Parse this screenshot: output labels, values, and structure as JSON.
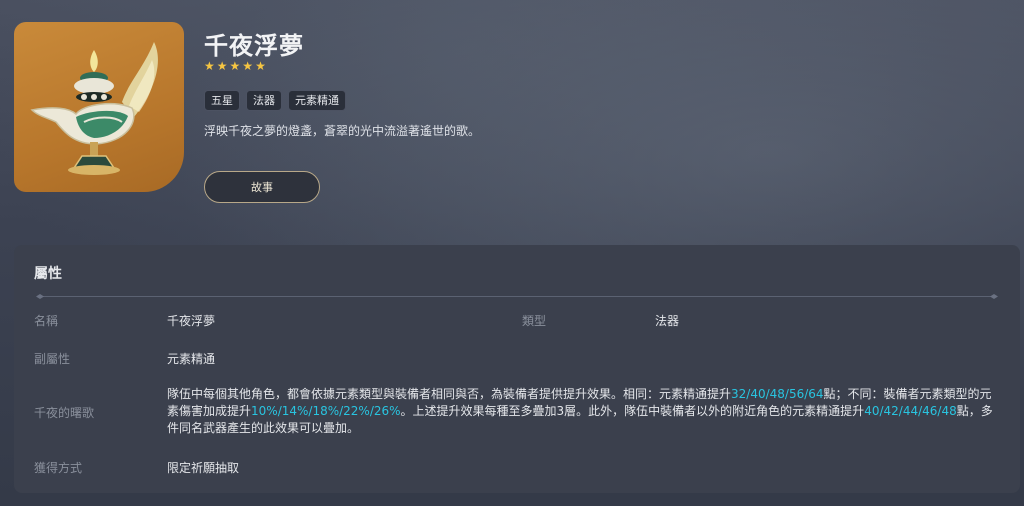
{
  "weapon": {
    "name": "千夜浮夢",
    "rarity": 5,
    "tags": [
      "五星",
      "法器",
      "元素精通"
    ],
    "description": "浮映千夜之夢的燈盞，蒼翠的光中流溢著遙世的歌。",
    "story_button": "故事",
    "image_icon": "magic-lamp-icon"
  },
  "attributes": {
    "section_title": "屬性",
    "name_label": "名稱",
    "name_value": "千夜浮夢",
    "type_label": "類型",
    "type_value": "法器",
    "substat_label": "副屬性",
    "substat_value": "元素精通",
    "effect_label": "千夜的曙歌",
    "effect": {
      "p1": "隊伍中每個其他角色，都會依據元素類型與裝備者相同與否，為裝備者提供提升效果。相同：元素精通提升",
      "v1": "32/40/48/56/64",
      "p2": "點；不同：裝備者元素類型的元素傷害加成提升",
      "v2": "10%/14%/18%/22%/26%",
      "p3": "。上述提升效果每種至多疊加3層。此外，隊伍中裝備者以外的附近角色的元素精通提升",
      "v3": "40/42/44/46/48",
      "p4": "點，多件同名武器產生的此效果可以疊加。"
    },
    "obtain_label": "獲得方式",
    "obtain_value": "限定祈願抽取"
  },
  "colors": {
    "star": "#f5c542",
    "highlight": "#29c4e0",
    "card_bg": "#c98a3a"
  }
}
